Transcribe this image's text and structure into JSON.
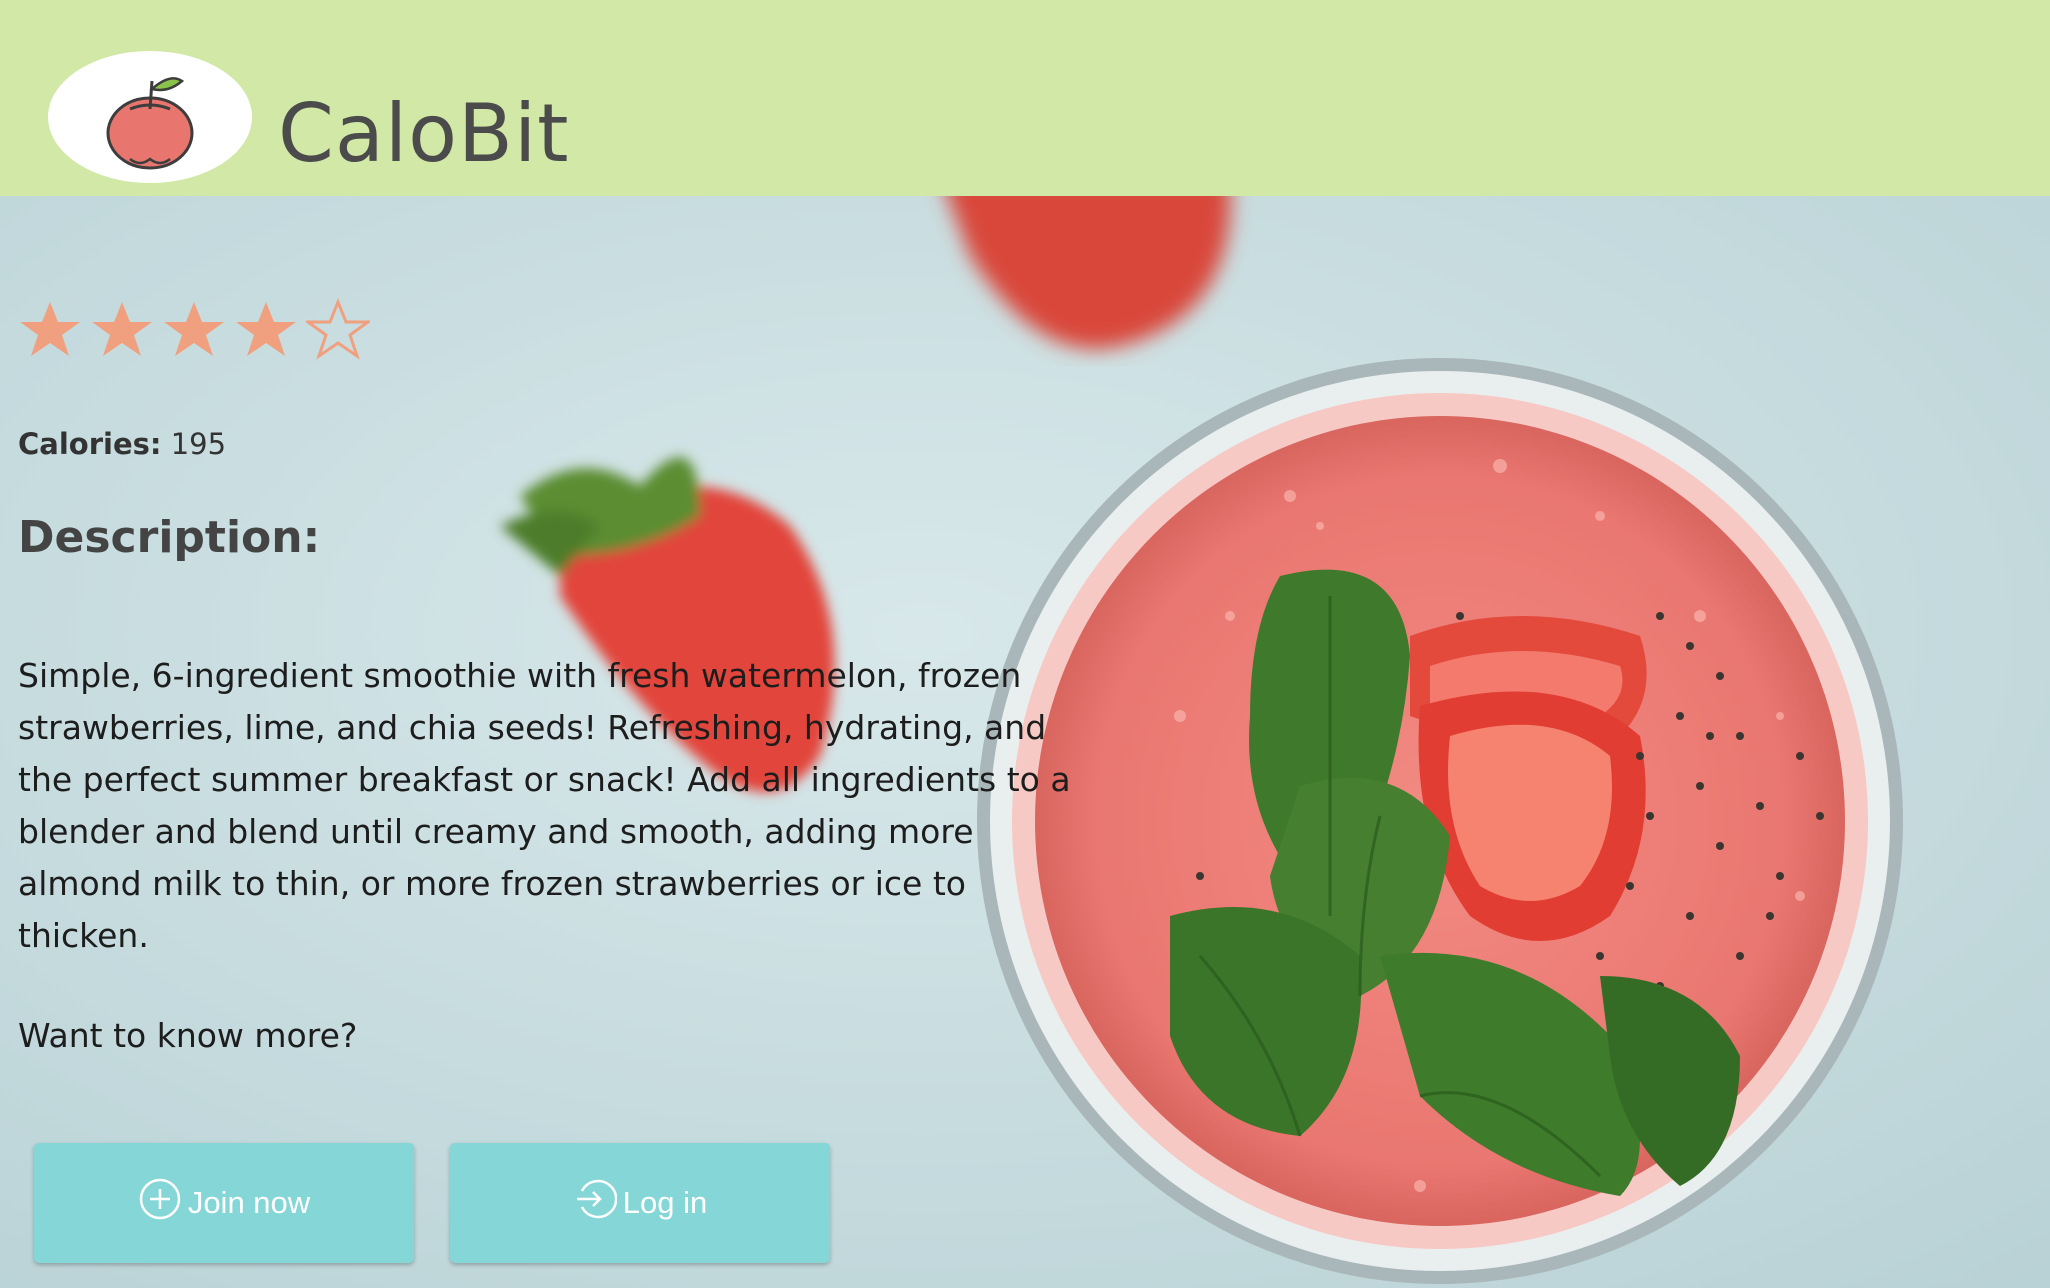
{
  "app": {
    "title": "CaloBit"
  },
  "rating": {
    "value": 4,
    "max": 5,
    "color": "#f0a07e"
  },
  "calories": {
    "label": "Calories:",
    "value": "195"
  },
  "description": {
    "heading": "Description:",
    "body": "Simple, 6-ingredient smoothie with fresh watermelon, frozen strawberries, lime, and chia seeds! Refreshing, hydrating, and the perfect summer breakfast or snack! Add all ingredients to a blender and blend until creamy and smooth, adding more almond milk to thin, or more frozen strawberries or ice to thicken.",
    "more": "Want to know more?"
  },
  "actions": {
    "join": {
      "label": "Join now",
      "icon": "plus-circle-icon"
    },
    "login": {
      "label": "Log in",
      "icon": "login-icon"
    }
  },
  "colors": {
    "header_bg": "#d1e8a6",
    "button_bg": "#85d6d6",
    "smoothie": "#f0847c"
  }
}
